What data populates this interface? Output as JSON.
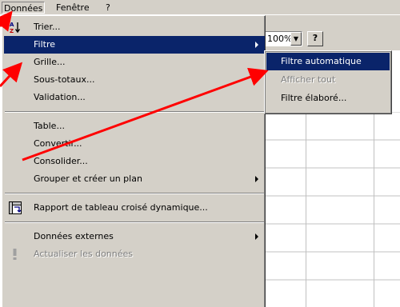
{
  "menubar": {
    "items": [
      {
        "label": "Données"
      },
      {
        "label": "Fenêtre"
      },
      {
        "label": "?"
      }
    ]
  },
  "toolbar": {
    "zoom_value": "100%",
    "help_label": "?"
  },
  "data_menu": {
    "items": [
      {
        "label": "Trier..."
      },
      {
        "label": "Filtre"
      },
      {
        "label": "Grille..."
      },
      {
        "label": "Sous-totaux..."
      },
      {
        "label": "Validation..."
      },
      {
        "label": "Table..."
      },
      {
        "label": "Convertir..."
      },
      {
        "label": "Consolider..."
      },
      {
        "label": "Grouper et créer un plan"
      },
      {
        "label": "Rapport de tableau croisé dynamique..."
      },
      {
        "label": "Données externes"
      },
      {
        "label": "Actualiser les données"
      }
    ]
  },
  "filter_submenu": {
    "items": [
      {
        "label": "Filtre automatique"
      },
      {
        "label": "Afficher tout"
      },
      {
        "label": "Filtre élaboré..."
      }
    ]
  },
  "colors": {
    "highlight": "#0a246a",
    "annotation_arrow": "#ff0000",
    "menu_face": "#d4d0c8"
  }
}
